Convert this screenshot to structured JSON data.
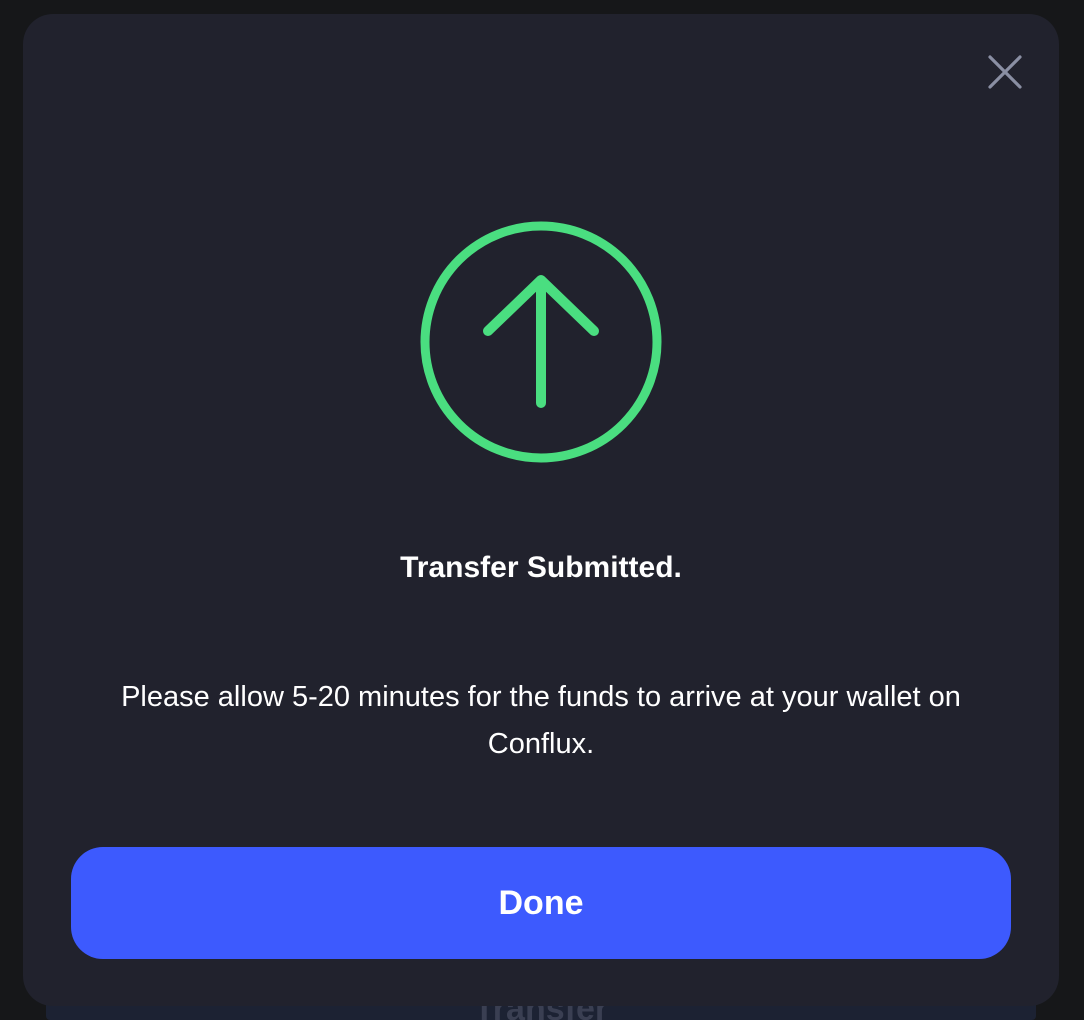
{
  "background": {
    "underlying_button_label": "Transfer"
  },
  "modal": {
    "close_icon": "close-icon",
    "status_icon": "arrow-up-circle-icon",
    "title": "Transfer Submitted.",
    "message": "Please allow 5-20 minutes for the funds to arrive at your wallet on Conflux.",
    "done_label": "Done"
  },
  "colors": {
    "modal_background": "#21222d",
    "accent_green": "#4ade80",
    "button_blue": "#3d5afe",
    "close_icon_gray": "#8a8fa3",
    "text_white": "#ffffff"
  }
}
